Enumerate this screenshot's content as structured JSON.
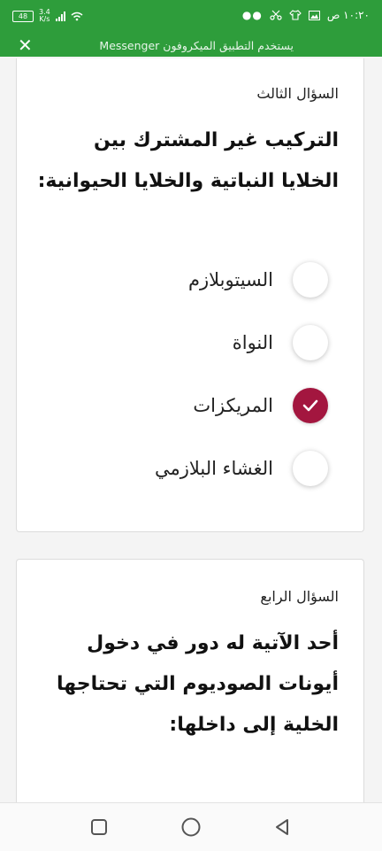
{
  "status_bar": {
    "battery": "48",
    "speed_top": "3.4",
    "speed_bottom": "K/s",
    "time": "١٠:٢٠ ص",
    "dots": "●●"
  },
  "messenger_bar": {
    "text": "يستخدم التطبيق الميكروفون Messenger",
    "close": "✕"
  },
  "question3": {
    "label": "السؤال الثالث",
    "text": "التركيب غير المشترك بين الخلايا النباتية والخلايا الحيوانية:",
    "options": [
      {
        "label": "السيتوبلازم",
        "checked": false
      },
      {
        "label": "النواة",
        "checked": false
      },
      {
        "label": "المريكزات",
        "checked": true
      },
      {
        "label": "الغشاء البلازمي",
        "checked": false
      }
    ]
  },
  "question4": {
    "label": "السؤال الرابع",
    "text": "أحد الآتية له دور في دخول أيونات الصوديوم التي تحتاجها الخلية إلى داخلها:"
  },
  "colors": {
    "status_green": "#2e9d3b",
    "selected": "#a3163f"
  },
  "nav": {
    "icons": [
      "recents-square-icon",
      "home-circle-icon",
      "back-triangle-icon"
    ]
  }
}
